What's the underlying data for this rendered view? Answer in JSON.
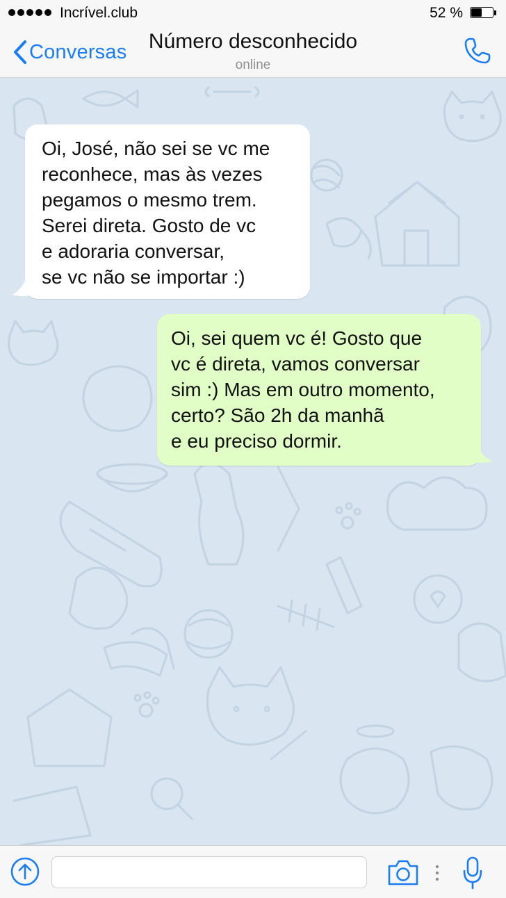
{
  "status_bar": {
    "carrier": "Incrível.club",
    "battery_percent": "52 %",
    "battery_level": 0.52
  },
  "nav": {
    "back_label": "Conversas",
    "title": "Número desconhecido",
    "subtitle": "online"
  },
  "messages": [
    {
      "direction": "incoming",
      "text": "Oi, José, não sei se vc me\nreconhece, mas às vezes\npegamos o mesmo trem.\nSerei direta. Gosto de vc\ne adoraria conversar,\nse vc não se importar :)"
    },
    {
      "direction": "outgoing",
      "text": "Oi, sei quem vc é! Gosto que\nvc é direta, vamos conversar\nsim :) Mas em outro momento,\ncerto? São 2h da manhã\ne eu preciso dormir."
    }
  ],
  "input_bar": {
    "placeholder": "",
    "icons": [
      "attach-arrow-icon",
      "camera-icon",
      "more-dots-icon",
      "microphone-icon"
    ]
  },
  "colors": {
    "accent": "#1a7df3",
    "chat_background": "#d9e5f0",
    "incoming_bubble": "#ffffff",
    "outgoing_bubble": "#e1fec6"
  }
}
